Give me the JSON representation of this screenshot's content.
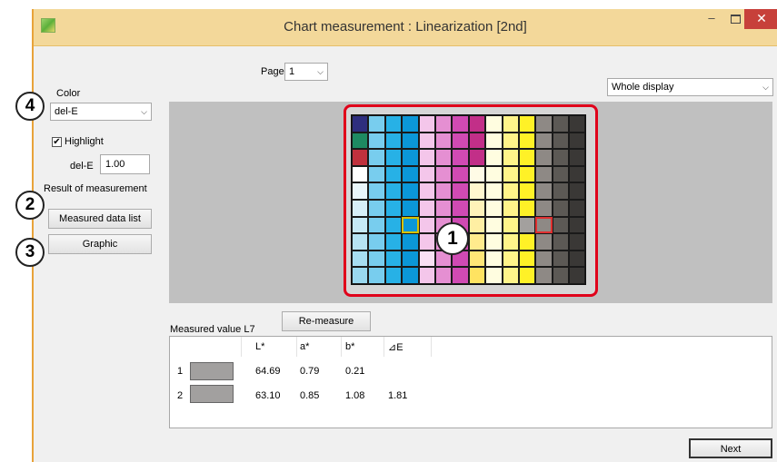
{
  "window": {
    "title": "Chart measurement : Linearization [2nd]",
    "min_glyph": "–",
    "close_glyph": "✕",
    "title_color": "#f3d89a",
    "close_color": "#c7403a"
  },
  "page": {
    "label": "Page",
    "value": "1"
  },
  "view_select": {
    "value": "Whole display"
  },
  "left_panel": {
    "color_label": "Color",
    "color_value": "del-E",
    "highlight_label": "Highlight",
    "highlight_checked": "✔",
    "dele_label": "del-E",
    "dele_value": "1.00",
    "result_label": "Result of measurement",
    "measured_data_list": "Measured data list",
    "graphic": "Graphic"
  },
  "badges": {
    "b1": "1",
    "b2": "2",
    "b3": "3",
    "b4": "4"
  },
  "remeasure": "Re-measure",
  "measured_value_label": "Measured value L7",
  "table": {
    "headers": [
      "L*",
      "a*",
      "b*",
      "⊿E"
    ],
    "rows": [
      {
        "index": "1",
        "L": "64.69",
        "a": "0.79",
        "b": "0.21",
        "dE": ""
      },
      {
        "index": "2",
        "L": "63.10",
        "a": "0.85",
        "b": "1.08",
        "dE": "1.81"
      }
    ]
  },
  "next": "Next",
  "accent": {
    "highlight_frame": "#e0001a",
    "selected_cell": "#d7c100",
    "compare_cell": "#e03030"
  }
}
